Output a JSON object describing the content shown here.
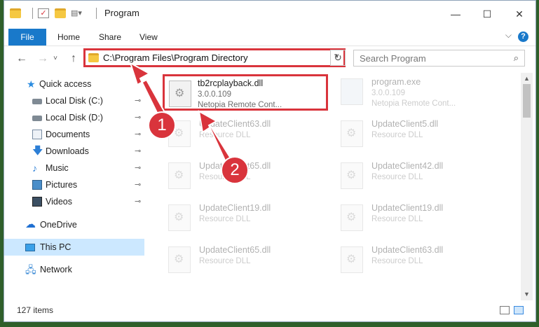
{
  "window": {
    "title": "Program",
    "controls": {
      "minimize": "—",
      "maximize": "☐",
      "close": "✕"
    }
  },
  "ribbon": {
    "tabs": [
      "File",
      "Home",
      "Share",
      "View"
    ],
    "help": "?"
  },
  "address": {
    "path": "C:\\Program Files\\Program Directory",
    "back": "←",
    "forward": "→",
    "recent": "˅",
    "up": "↑",
    "dropdown": "˅",
    "refresh": "↻"
  },
  "search": {
    "placeholder": "Search Program",
    "icon": "⌕"
  },
  "sidebar": {
    "items": [
      {
        "label": "Quick access",
        "icon": "star-icon"
      },
      {
        "label": "Local Disk (C:)",
        "icon": "disk-icon",
        "pinned": true
      },
      {
        "label": "Local Disk (D:)",
        "icon": "disk-icon",
        "pinned": true
      },
      {
        "label": "Documents",
        "icon": "documents-icon",
        "pinned": true
      },
      {
        "label": "Downloads",
        "icon": "download-icon",
        "pinned": true
      },
      {
        "label": "Music",
        "icon": "music-icon",
        "pinned": true
      },
      {
        "label": "Pictures",
        "icon": "pictures-icon",
        "pinned": true
      },
      {
        "label": "Videos",
        "icon": "videos-icon",
        "pinned": true
      },
      {
        "label": "OneDrive",
        "icon": "cloud-icon"
      },
      {
        "label": "This PC",
        "icon": "pc-icon",
        "selected": true
      },
      {
        "label": "Network",
        "icon": "network-icon"
      }
    ],
    "pin_glyph": "📌"
  },
  "files": [
    {
      "name": "tb2rcplayback.dll",
      "line2": "3.0.0.109",
      "line3": "Netopia Remote Cont...",
      "highlighted": true
    },
    {
      "name": "program.exe",
      "line2": "3.0.0.109",
      "line3": "Netopia Remote Cont...",
      "faded": true
    },
    {
      "name": "UpdateClient63.dll",
      "line2": "Resource DLL",
      "faded": true
    },
    {
      "name": "UpdateClient5.dll",
      "line2": "Resource DLL",
      "faded": true
    },
    {
      "name": "UpdateClient65.dll",
      "line2": "Resource DLL",
      "faded": true
    },
    {
      "name": "UpdateClient42.dll",
      "line2": "Resource DLL",
      "faded": true
    },
    {
      "name": "UpdateClient19.dll",
      "line2": "Resource DLL",
      "faded": true
    },
    {
      "name": "UpdateClient19.dll",
      "line2": "Resource DLL",
      "faded": true
    },
    {
      "name": "UpdateClient65.dll",
      "line2": "Resource DLL",
      "faded": true
    },
    {
      "name": "UpdateClient63.dll",
      "line2": "Resource DLL",
      "faded": true
    }
  ],
  "status": {
    "item_count": "127 items"
  },
  "annotations": {
    "badge1": "1",
    "badge2": "2"
  },
  "colors": {
    "accent": "#1979ca",
    "annotation": "#d9343c",
    "selection": "#cce8ff"
  }
}
